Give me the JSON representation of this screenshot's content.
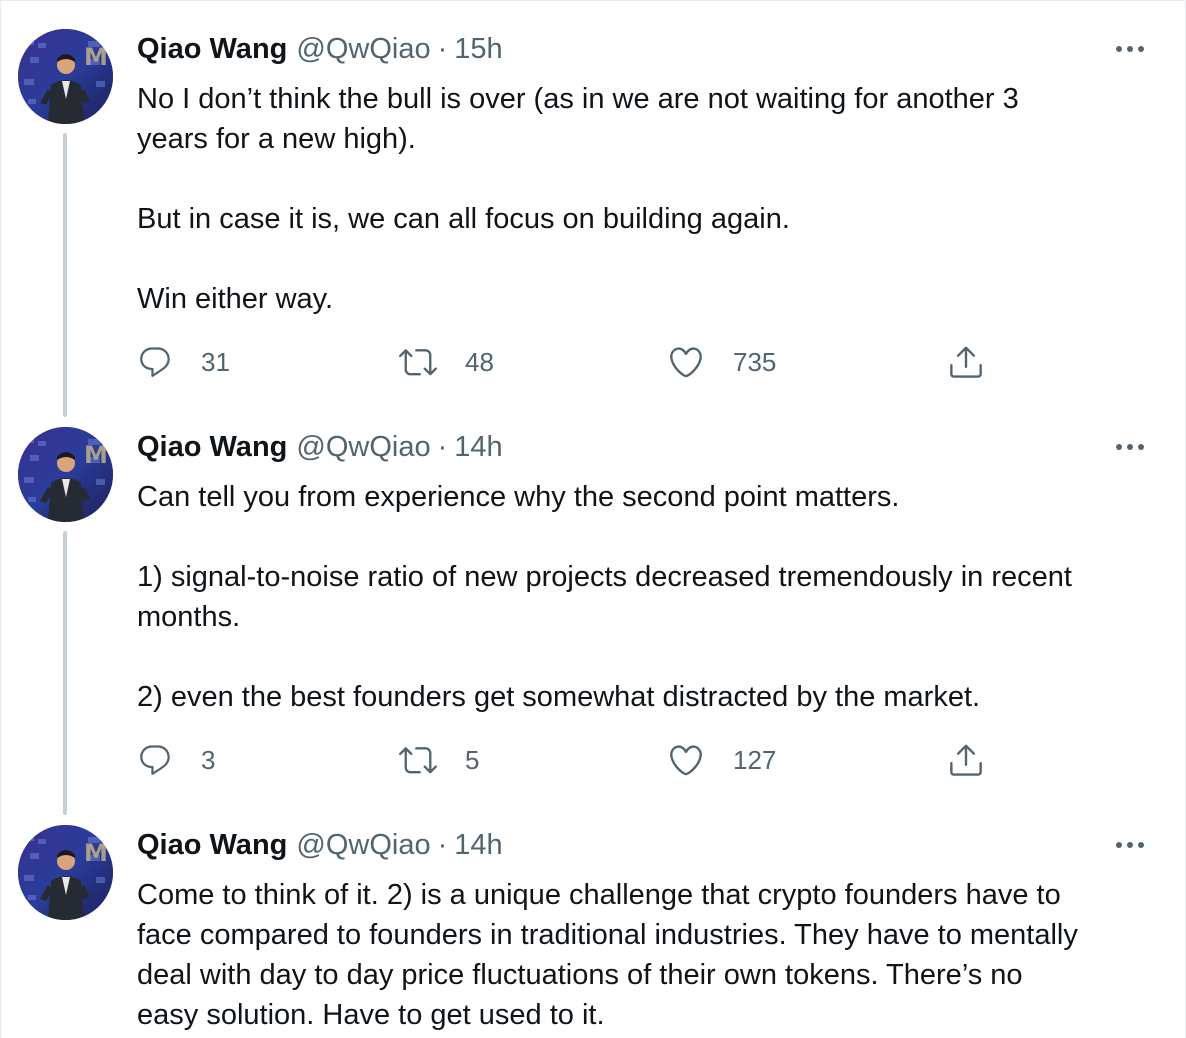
{
  "colors": {
    "text": "#0f1419",
    "muted": "#536471",
    "thread_line": "#c4cfd6",
    "divider": "#e6ecf0"
  },
  "tweets": [
    {
      "author": {
        "name": "Qiao Wang",
        "handle": "@QwQiao",
        "avatar_icon": "avatar-photo"
      },
      "separator": "·",
      "time": "15h",
      "paragraphs": [
        "No I don’t think the bull is over (as in we are not waiting for another 3",
        "years for a new high).",
        "But in case it is, we can all focus on building again.",
        "Win either way."
      ],
      "reply_count": "31",
      "retweet_count": "48",
      "like_count": "735"
    },
    {
      "author": {
        "name": "Qiao Wang",
        "handle": "@QwQiao",
        "avatar_icon": "avatar-photo"
      },
      "separator": "·",
      "time": "14h",
      "paragraphs": [
        "Can tell you from experience why the second point matters.",
        "1) signal-to-noise ratio of new projects decreased tremendously in recent",
        "months.",
        "2) even the best founders get somewhat distracted by the market."
      ],
      "reply_count": "3",
      "retweet_count": "5",
      "like_count": "127"
    },
    {
      "author": {
        "name": "Qiao Wang",
        "handle": "@QwQiao",
        "avatar_icon": "avatar-photo"
      },
      "separator": "·",
      "time": "14h",
      "paragraphs": [
        "Come to think of it. 2) is a unique challenge that crypto founders have to",
        "face compared to founders in traditional industries. They have to mentally",
        "deal with day to day price fluctuations of their own tokens. There’s no",
        "easy solution. Have to get used to it."
      ]
    }
  ],
  "icons": {
    "reply": "reply-icon",
    "retweet": "retweet-icon",
    "like": "heart-icon",
    "share": "share-icon",
    "more": "more-icon"
  }
}
